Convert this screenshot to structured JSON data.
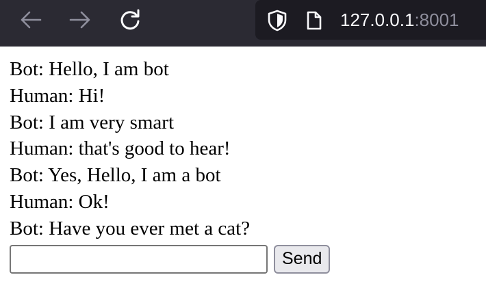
{
  "browser": {
    "url_host": "127.0.0.1",
    "url_port": ":8001",
    "icons": {
      "back": "arrow-left",
      "forward": "arrow-right",
      "reload": "reload",
      "shield": "tracking-protection-shield",
      "page": "page"
    }
  },
  "chat": {
    "messages": [
      "Bot: Hello, I am bot",
      "Human: Hi!",
      "Bot: I am very smart",
      "Human: that's good to hear!",
      "Bot: Yes, Hello, I am a bot",
      "Human: Ok!",
      "Bot: Have you ever met a cat?"
    ],
    "input_value": "",
    "send_label": "Send"
  },
  "colors": {
    "toolbar_bg": "#2b2a33",
    "urlbar_bg": "#1c1b22",
    "icon": "#fbfbfe",
    "icon_dim": "#8f8f9d"
  }
}
